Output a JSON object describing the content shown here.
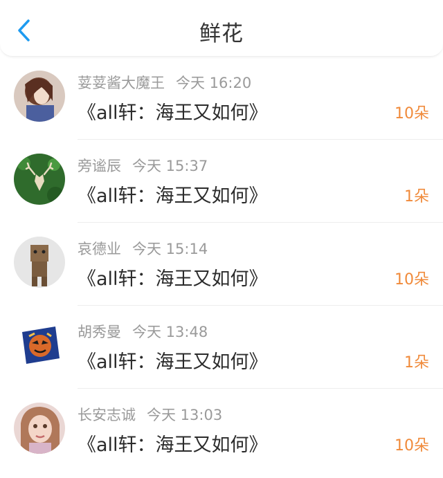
{
  "header": {
    "title": "鲜花",
    "back_icon": "chevron-left-icon",
    "accent_color": "#1e9bf0"
  },
  "items": [
    {
      "user": "荽荽酱大魔王",
      "time": "今天 16:20",
      "book": "《all轩：海王又如何》",
      "count": "10朵"
    },
    {
      "user": "旁谧辰",
      "time": "今天 15:37",
      "book": "《all轩：海王又如何》",
      "count": "1朵"
    },
    {
      "user": "哀德业",
      "time": "今天 15:14",
      "book": "《all轩：海王又如何》",
      "count": "10朵"
    },
    {
      "user": "胡秀曼",
      "time": "今天 13:48",
      "book": "《all轩：海王又如何》",
      "count": "1朵"
    },
    {
      "user": "长安志诚",
      "time": "今天 13:03",
      "book": "《all轩：海王又如何》",
      "count": "10朵"
    }
  ],
  "colors": {
    "count": "#f08a3a",
    "meta": "#9a9a9a",
    "text": "#2b2b2b"
  }
}
